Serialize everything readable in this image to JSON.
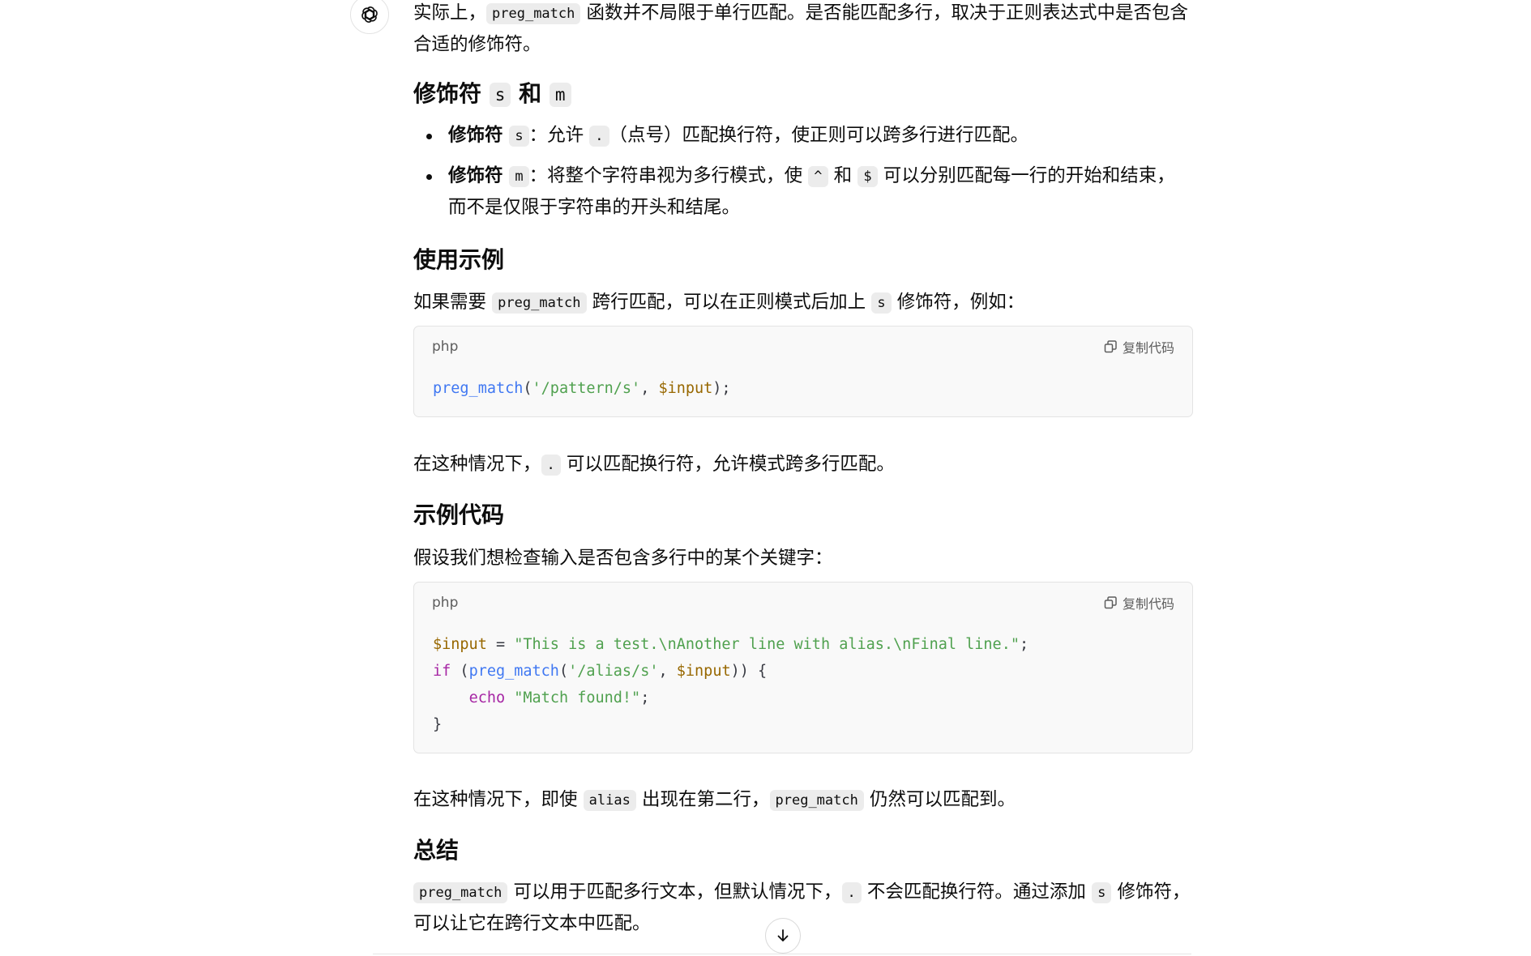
{
  "intro": {
    "before": "实际上，",
    "code": "preg_match",
    "after": " 函数并不局限于单行匹配。是否能匹配多行，取决于正则表达式中是否包含合适的修饰符。"
  },
  "modifiers_heading": {
    "prefix": "修饰符 ",
    "code1": "s",
    "mid": " 和 ",
    "code2": "m"
  },
  "bullets": [
    {
      "bold": "修饰符 ",
      "code": "s",
      "text1": "：允许 ",
      "code2": ".",
      "text2": "（点号）匹配换行符，使正则可以跨多行进行匹配。"
    },
    {
      "bold": "修饰符 ",
      "code": "m",
      "text1": "：将整个字符串视为多行模式，使 ",
      "code2": "^",
      "mid": " 和 ",
      "code3": "$",
      "text2": " 可以分别匹配每一行的开始和结束，而不是仅限于字符串的开头和结尾。"
    }
  ],
  "usage_heading": "使用示例",
  "usage_para": {
    "before": "如果需要 ",
    "code": "preg_match",
    "mid": " 跨行匹配，可以在正则模式后加上 ",
    "code2": "s",
    "after": " 修饰符，例如："
  },
  "code_block_1": {
    "lang": "php",
    "copy_label": "复制代码",
    "fn": "preg_match",
    "open": "(",
    "str": "'/pattern/s'",
    "comma": ", ",
    "var": "$input",
    "close": ");"
  },
  "para_after_1": {
    "before": "在这种情况下，",
    "code": ".",
    "after": " 可以匹配换行符，允许模式跨多行匹配。"
  },
  "example_heading": "示例代码",
  "example_para": "假设我们想检查输入是否包含多行中的某个关键字：",
  "code_block_2": {
    "lang": "php",
    "copy_label": "复制代码",
    "l1_var": "$input",
    "l1_eq": " = ",
    "l1_str": "\"This is a test.\\nAnother line with alias.\\nFinal line.\"",
    "l1_end": ";",
    "l2_kw": "if",
    "l2_open": " (",
    "l2_fn": "preg_match",
    "l2_p": "(",
    "l2_str": "'/alias/s'",
    "l2_comma": ", ",
    "l2_var": "$input",
    "l2_end": ")) {",
    "l3_indent": "    ",
    "l3_kw": "echo",
    "l3_sp": " ",
    "l3_str": "\"Match found!\"",
    "l3_end": ";",
    "l4": "}"
  },
  "para_after_2": {
    "before": "在这种情况下，即使 ",
    "code": "alias",
    "mid": " 出现在第二行，",
    "code2": "preg_match",
    "after": " 仍然可以匹配到。"
  },
  "summary_heading": "总结",
  "summary_para": {
    "code": "preg_match",
    "t1": " 可以用于匹配多行文本，但默认情况下，",
    "code2": ".",
    "t2": " 不会匹配换行符。通过添加 ",
    "code3": "s",
    "t3": " 修饰符，可以让它在跨行文本中匹配。"
  },
  "icons": {
    "assistant": "openai-logo-icon",
    "copy": "copy-icon",
    "scroll": "arrow-down-icon"
  }
}
